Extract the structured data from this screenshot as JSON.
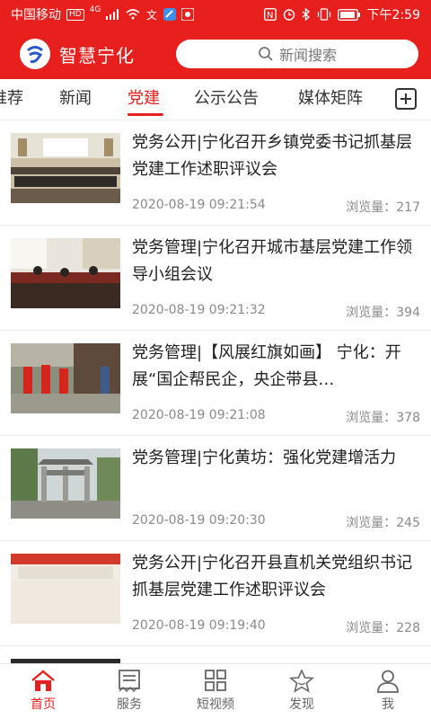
{
  "status_bar": {
    "carrier": "中国移动",
    "hd": "HD",
    "network": "4G",
    "time": "下午2:59"
  },
  "header": {
    "app_title": "智慧宁化",
    "search_placeholder": "新闻搜索"
  },
  "tabs": [
    {
      "label": "推荐"
    },
    {
      "label": "新闻"
    },
    {
      "label": "党建"
    },
    {
      "label": "公示公告"
    },
    {
      "label": "媒体矩阵"
    }
  ],
  "active_tab": "党建",
  "news": [
    {
      "title": "党务公开|宁化召开乡镇党委书记抓基层党建工作述职评议会",
      "date": "2020-08-19 09:21:54",
      "views": "浏览量：217"
    },
    {
      "title": "党务管理|宁化召开城市基层党建工作领导小组会议",
      "date": "2020-08-19 09:21:32",
      "views": "浏览量：394"
    },
    {
      "title": "党务管理|【风展红旗如画】 宁化：开展“国企帮民企，央企带县…",
      "date": "2020-08-19 09:21:08",
      "views": "浏览量：378"
    },
    {
      "title": "党务管理|宁化黄坊：强化党建增活力",
      "date": "2020-08-19 09:20:30",
      "views": "浏览量：245"
    },
    {
      "title": "党务公开|宁化召开县直机关党组织书记抓基层党建工作述职评议会",
      "date": "2020-08-19 09:19:40",
      "views": "浏览量：228"
    }
  ],
  "bottom_nav": [
    {
      "label": "首页",
      "icon": "home-icon"
    },
    {
      "label": "服务",
      "icon": "service-icon"
    },
    {
      "label": "短视频",
      "icon": "grid-icon"
    },
    {
      "label": "发现",
      "icon": "discover-icon"
    },
    {
      "label": "我",
      "icon": "user-icon"
    }
  ],
  "colors": {
    "brand": "#e8201d",
    "text": "#222222",
    "meta": "#8a8a8a"
  }
}
